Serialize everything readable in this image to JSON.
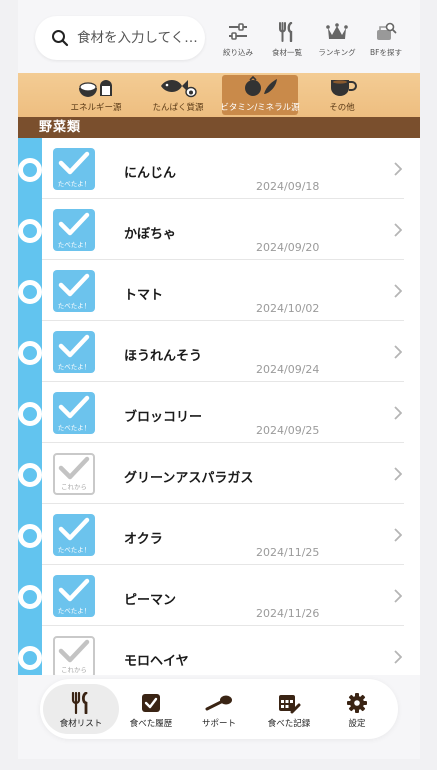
{
  "search": {
    "placeholder": "食材を入力してく…"
  },
  "header_buttons": [
    {
      "label": "絞り込み",
      "icon": "sliders-icon"
    },
    {
      "label": "食材一覧",
      "icon": "utensils-icon"
    },
    {
      "label": "ランキング",
      "icon": "crown-icon"
    },
    {
      "label": "BFを探す",
      "icon": "lunchbox-search-icon"
    }
  ],
  "categories": [
    {
      "label": "エネルギー源",
      "icon": "rice-bread-icon",
      "active": false
    },
    {
      "label": "たんぱく質源",
      "icon": "fish-egg-icon",
      "active": false
    },
    {
      "label": "ビタミン/ミネラル源",
      "icon": "vegetable-icon",
      "active": true
    },
    {
      "label": "その他",
      "icon": "cup-icon",
      "active": false
    }
  ],
  "section_title": "野菜類",
  "checkbox_labels": {
    "eaten": "たべたよ！",
    "not_yet": "これから"
  },
  "foods": [
    {
      "name": "にんじん",
      "date": "2024/09/18",
      "eaten": true
    },
    {
      "name": "かぼちゃ",
      "date": "2024/09/20",
      "eaten": true
    },
    {
      "name": "トマト",
      "date": "2024/10/02",
      "eaten": true
    },
    {
      "name": "ほうれんそう",
      "date": "2024/09/24",
      "eaten": true
    },
    {
      "name": "ブロッコリー",
      "date": "2024/09/25",
      "eaten": true
    },
    {
      "name": "グリーンアスパラガス",
      "date": "",
      "eaten": false
    },
    {
      "name": "オクラ",
      "date": "2024/11/25",
      "eaten": true
    },
    {
      "name": "ピーマン",
      "date": "2024/11/26",
      "eaten": true
    },
    {
      "name": "モロヘイヤ",
      "date": "",
      "eaten": false
    }
  ],
  "bottom_nav": [
    {
      "label": "食材リスト",
      "icon": "utensils-icon",
      "active": true
    },
    {
      "label": "食べた履歴",
      "icon": "checkbox-icon",
      "active": false
    },
    {
      "label": "サポート",
      "icon": "spoon-icon",
      "active": false
    },
    {
      "label": "食べた記録",
      "icon": "calendar-edit-icon",
      "active": false
    },
    {
      "label": "設定",
      "icon": "gear-icon",
      "active": false
    }
  ],
  "colors": {
    "accent_blue": "#62c4ef",
    "section_brown": "#7a4f2d",
    "tab_tan": "#eebe80"
  }
}
